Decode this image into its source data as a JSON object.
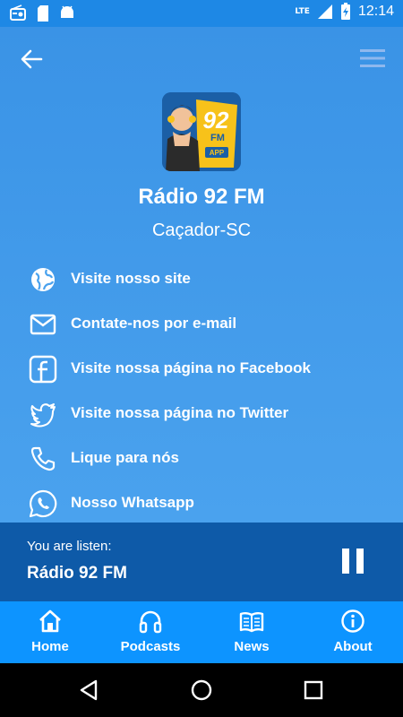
{
  "status_bar": {
    "time": "12:14",
    "network": "LTE",
    "icons": [
      "radio-icon",
      "sd-card-icon",
      "android-icon",
      "signal-icon",
      "battery-icon"
    ]
  },
  "header": {
    "back_icon": "arrow-left-icon",
    "menu_icon": "hamburger-menu-icon"
  },
  "station": {
    "logo_text": "92",
    "logo_fm": "FM",
    "logo_app": "APP",
    "title": "Rádio 92 FM",
    "city": "Caçador-SC"
  },
  "links": [
    {
      "icon": "globe-icon",
      "label": "Visite nosso site"
    },
    {
      "icon": "email-icon",
      "label": "Contate-nos por e-mail"
    },
    {
      "icon": "facebook-icon",
      "label": "Visite nossa página no Facebook"
    },
    {
      "icon": "twitter-icon",
      "label": "Visite nossa página no Twitter"
    },
    {
      "icon": "phone-icon",
      "label": "Lique para nós"
    },
    {
      "icon": "whatsapp-icon",
      "label": "Nosso Whatsapp"
    }
  ],
  "player": {
    "subtitle": "You are listen:",
    "station_name": "Rádio 92 FM",
    "control_icon": "pause-icon"
  },
  "tabs": [
    {
      "icon": "home-icon",
      "label": "Home"
    },
    {
      "icon": "headphones-icon",
      "label": "Podcasts"
    },
    {
      "icon": "book-icon",
      "label": "News"
    },
    {
      "icon": "info-icon",
      "label": "About"
    }
  ],
  "colors": {
    "status_bar": "#1e88e5",
    "main_background": "#4aa2ee",
    "player_background": "#0e5aa8",
    "tabbar_background": "#0d94ff",
    "logo_accent": "#f7c21a"
  }
}
